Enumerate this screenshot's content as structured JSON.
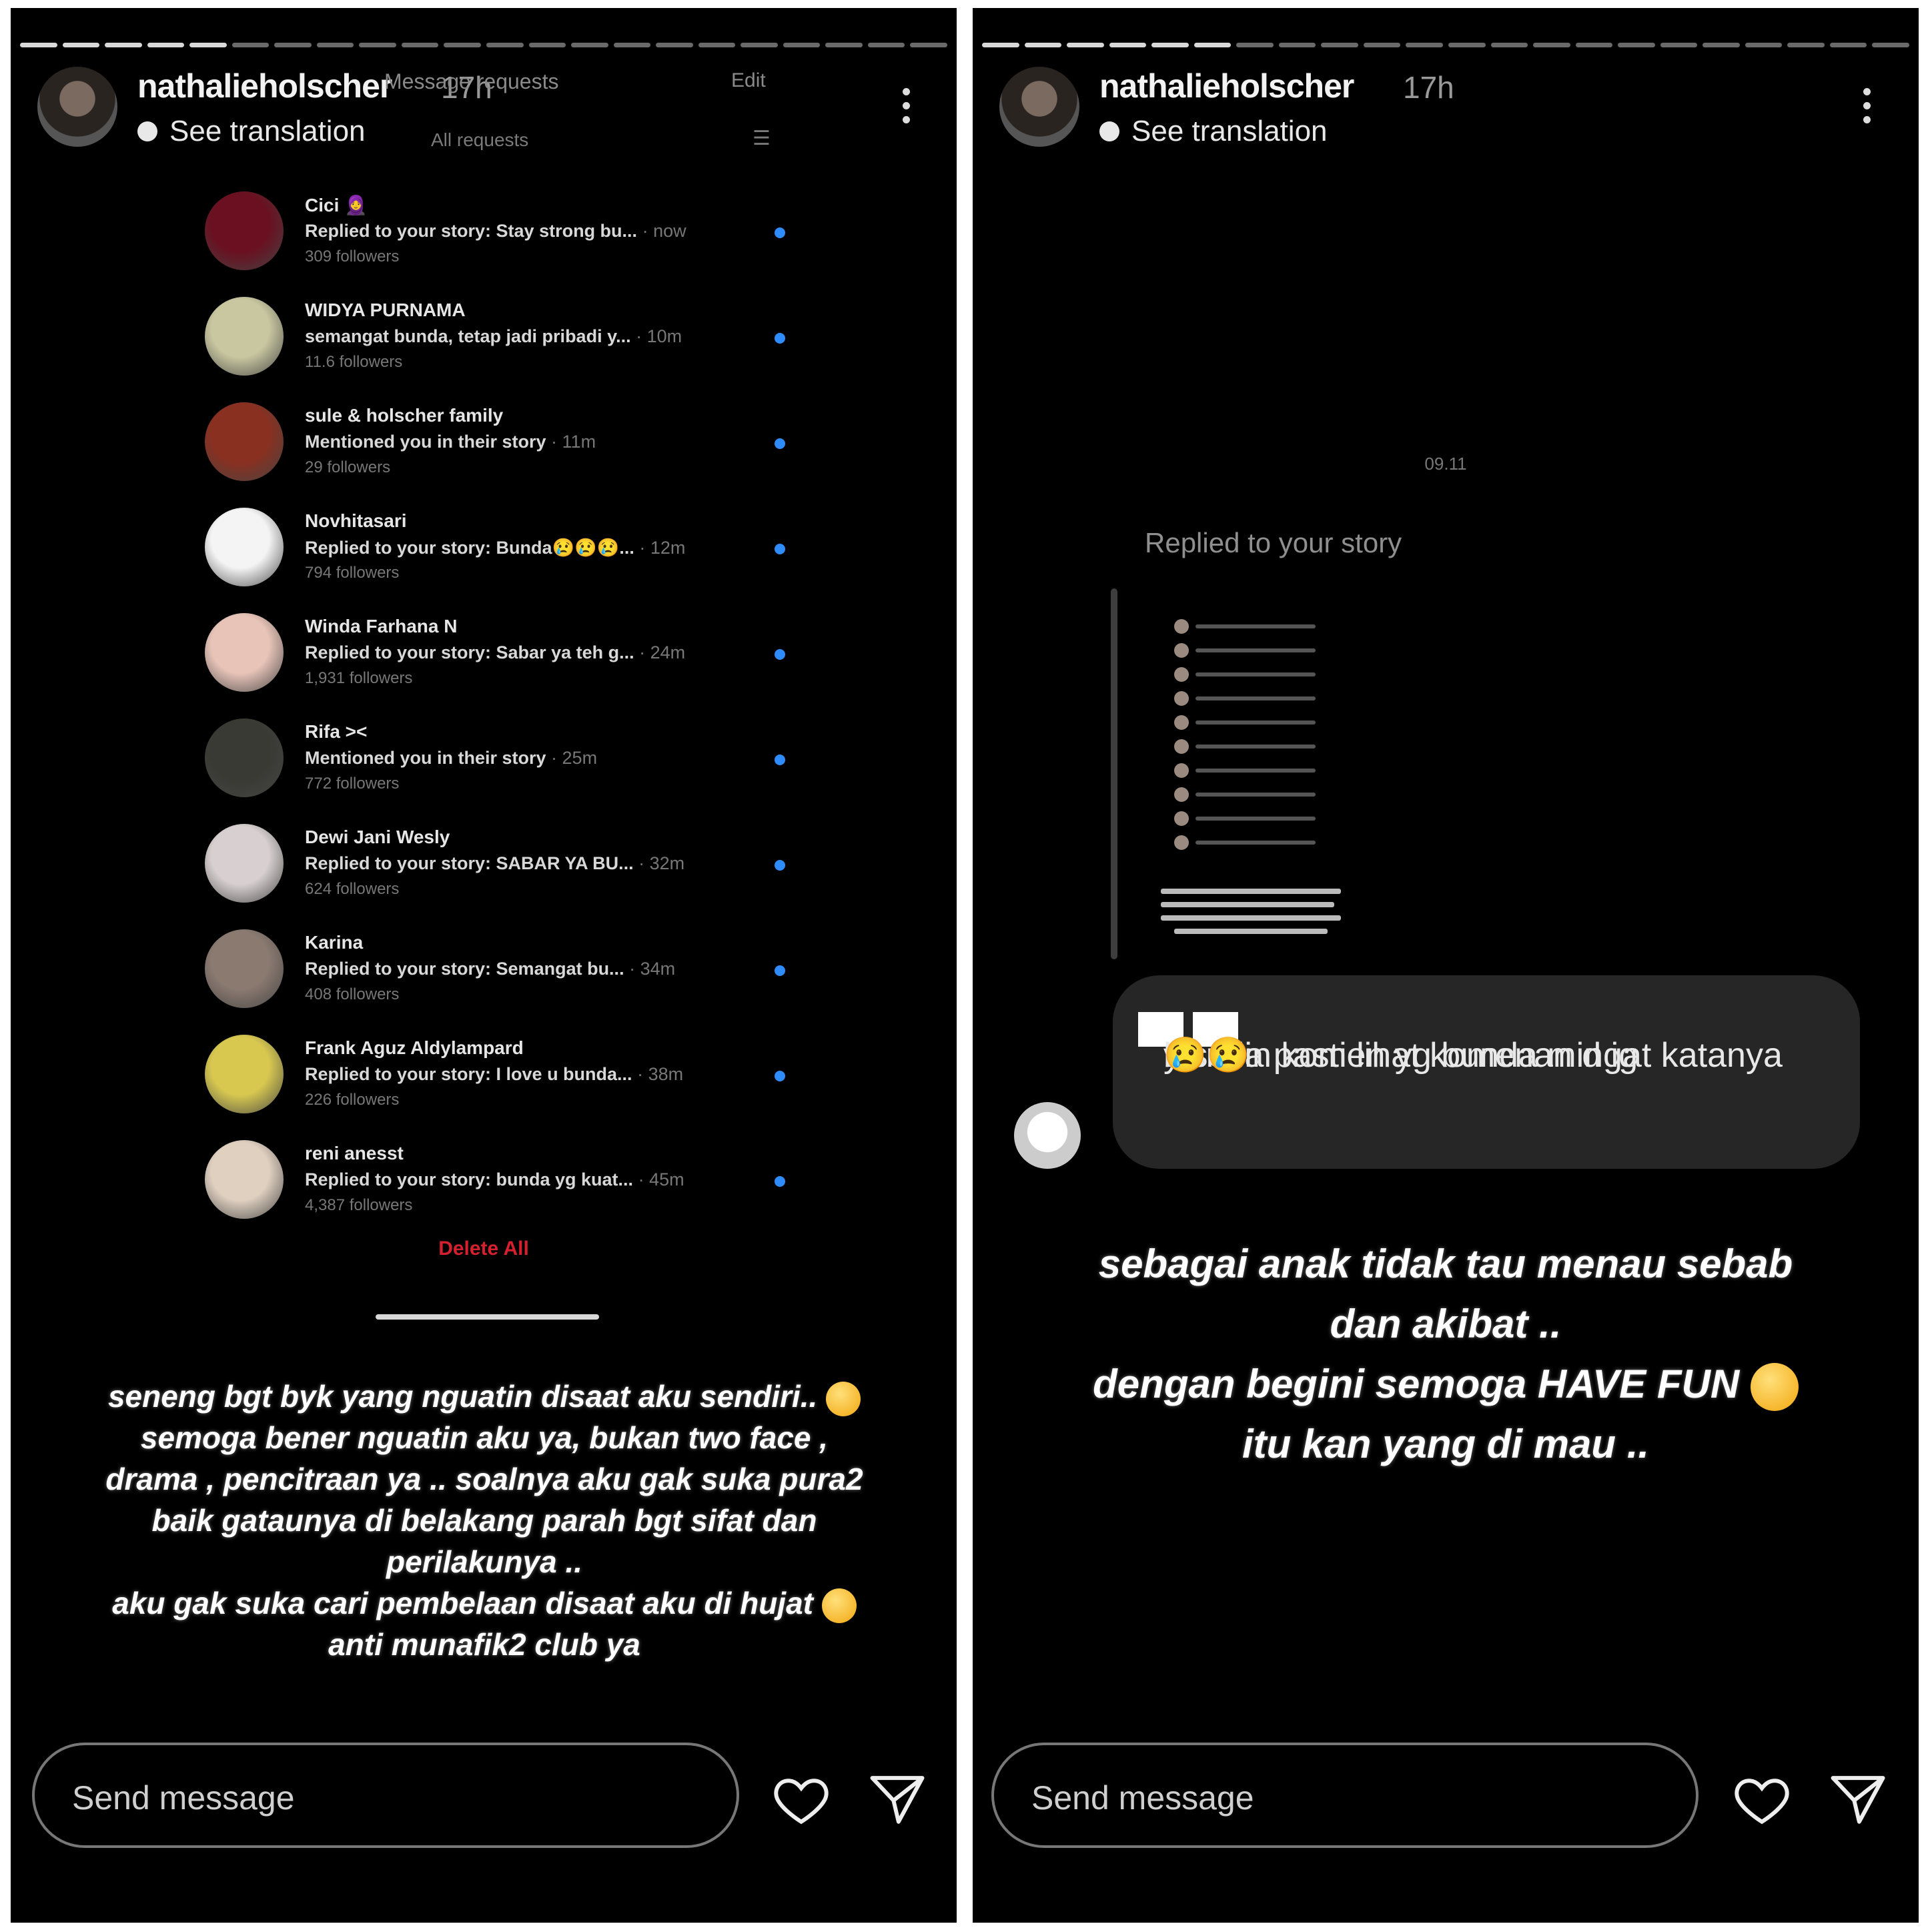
{
  "left": {
    "username": "nathalieholscher",
    "time": "17h",
    "see_translation": "See translation",
    "overlay": {
      "title": "Message requests",
      "edit": "Edit",
      "subtitle": "All requests",
      "requests": [
        {
          "name": "Cici 🧕",
          "message": "Replied to your story: Stay strong bu...",
          "time": "· now",
          "followers": "309 followers"
        },
        {
          "name": "WIDYA PURNAMA",
          "message": "semangat bunda, tetap jadi pribadi y...",
          "time": "· 10m",
          "followers": "11.6 followers"
        },
        {
          "name": "sule & holscher family",
          "message": "Mentioned you in their story",
          "time": "· 11m",
          "followers": "29 followers"
        },
        {
          "name": "Novhitasari",
          "message": "Replied to your story: Bunda😢😢😢...",
          "time": "· 12m",
          "followers": "794 followers"
        },
        {
          "name": "Winda Farhana N",
          "message": "Replied to your story: Sabar ya teh g...",
          "time": "· 24m",
          "followers": "1,931 followers"
        },
        {
          "name": "Rifa ><",
          "message": "Mentioned you in their story",
          "time": "· 25m",
          "followers": "772 followers"
        },
        {
          "name": "Dewi Jani Wesly",
          "message": "Replied to your story: SABAR YA BU...",
          "time": "· 32m",
          "followers": "624 followers"
        },
        {
          "name": "Karina",
          "message": "Replied to your story: Semangat bu...",
          "time": "· 34m",
          "followers": "408 followers"
        },
        {
          "name": "Frank Aguz Aldylampard",
          "message": "Replied to your story: I love u bunda...",
          "time": "· 38m",
          "followers": "226 followers"
        },
        {
          "name": "reni anesst",
          "message": "Replied to your story: bunda yg kuat...",
          "time": "· 45m",
          "followers": "4,387 followers"
        }
      ],
      "delete_all": "Delete All"
    },
    "caption": [
      "seneng bgt byk yang nguatin disaat aku sendiri..",
      "semoga bener nguatin aku ya, bukan two face ,",
      "drama , pencitraan ya .. soalnya aku gak suka pura2",
      "baik gataunya di belakang parah bgt sifat dan",
      "perilakunya ..",
      "aku gak suka cari pembelaan disaat aku di hujat",
      "anti munafik2 club ya"
    ],
    "send_placeholder": "Send message",
    "icons": {
      "like": "heart-icon",
      "share": "paper-plane-icon",
      "more": "more-vertical-icon"
    }
  },
  "right": {
    "username": "nathalieholscher",
    "time": "17h",
    "see_translation": "See translation",
    "reply_timestamp": "09.11",
    "replied_label": "Replied to your story",
    "message_part1": "Bunda pasti lihat komenan d ig",
    "message_part2": "ya si",
    "message_part3": "blsesin komen yg bunda mingat katanya",
    "message_emojis": "😢😢",
    "caption": [
      "sebagai anak tidak tau menau sebab",
      "dan akibat ..",
      "dengan begini semoga HAVE FUN",
      "itu kan yang di mau .."
    ],
    "send_placeholder": "Send message"
  },
  "colors": {
    "background": "#000000",
    "unread_dot": "#2f8cff",
    "delete_all": "#d4202f",
    "bubble": "#262626"
  }
}
